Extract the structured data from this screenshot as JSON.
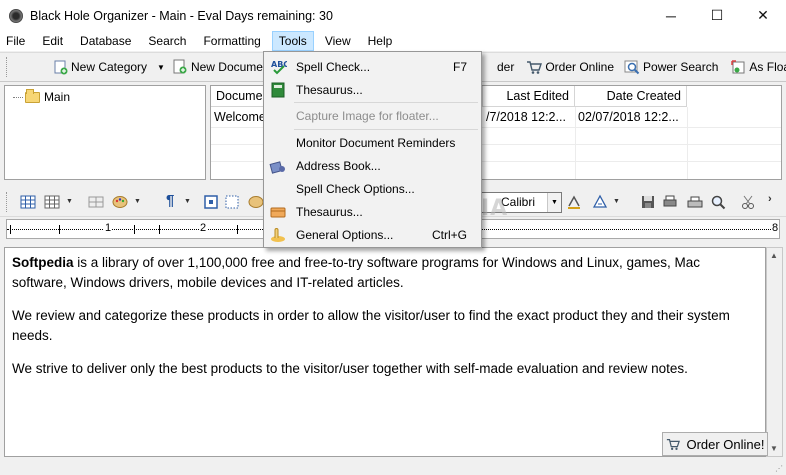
{
  "window": {
    "title": "Black Hole Organizer - Main - Eval Days remaining: 30",
    "minimize": "─",
    "maximize": "☐",
    "close": "✕"
  },
  "menu": {
    "items": [
      "File",
      "Edit",
      "Database",
      "Search",
      "Formatting",
      "Tools",
      "View",
      "Help"
    ],
    "active": "Tools"
  },
  "toolbar": {
    "new_category": "New Category",
    "new_document": "New Document",
    "partial_hidden": "der",
    "order_online": "Order Online",
    "power_search": "Power Search",
    "as_floater": "As Floater"
  },
  "tree": {
    "root": "Main"
  },
  "list": {
    "columns": [
      "Docume",
      "Last Edited",
      "Date Created"
    ],
    "rows": [
      {
        "name": "Welcome",
        "last_edited": "/7/2018 12:2...",
        "date_created": "02/07/2018 12:2..."
      }
    ]
  },
  "format_bar": {
    "font_name": "Calibri"
  },
  "ruler": {
    "labels": [
      "1",
      "2",
      "8"
    ]
  },
  "document": {
    "p1_bold": "Softpedia",
    "p1_rest": " is a library of over 1,100,000 free and free-to-try software programs for Windows and Linux, games, Mac software, Windows drivers, mobile devices and IT-related articles.",
    "p2": "We review and categorize these products in order to allow the visitor/user to find the exact product they and their system needs.",
    "p3": "We strive to deliver only the best products to the visitor/user together with self-made evaluation and review notes."
  },
  "order_online_button": "Order Online!",
  "watermark": "SOFTPEDIA",
  "tools_menu": {
    "spell_check": "Spell Check...",
    "spell_check_shortcut": "F7",
    "thesaurus": "Thesaurus...",
    "capture_image": "Capture Image for floater...",
    "monitor_reminders": "Monitor Document Reminders",
    "address_book": "Address Book...",
    "spell_check_options": "Spell Check Options...",
    "thesaurus2": "Thesaurus...",
    "general_options": "General Options...",
    "general_options_shortcut": "Ctrl+G"
  },
  "colors": {
    "menu_active_bg": "#cce8ff",
    "menu_active_border": "#99d1ff",
    "folder": "#f7d675"
  }
}
